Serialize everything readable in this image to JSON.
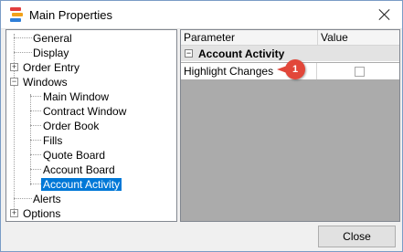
{
  "window": {
    "title": "Main Properties"
  },
  "tree": {
    "items": [
      {
        "label": "General"
      },
      {
        "label": "Display"
      },
      {
        "label": "Order Entry",
        "expander": "+"
      },
      {
        "label": "Windows",
        "expander": "−"
      },
      {
        "label": "Main Window"
      },
      {
        "label": "Contract Window"
      },
      {
        "label": "Order Book"
      },
      {
        "label": "Fills"
      },
      {
        "label": "Quote Board"
      },
      {
        "label": "Account Board"
      },
      {
        "label": "Account Activity",
        "selected": true
      },
      {
        "label": "Alerts"
      },
      {
        "label": "Options",
        "expander": "+"
      }
    ]
  },
  "grid": {
    "headers": {
      "parameter": "Parameter",
      "value": "Value"
    },
    "category": {
      "label": "Account Activity",
      "expander": "−"
    },
    "rows": [
      {
        "name": "Highlight Changes",
        "checked": false
      }
    ],
    "callout": "1"
  },
  "buttons": {
    "close": "Close"
  },
  "colors": {
    "selection": "#0078d7",
    "callout": "#e2473a"
  }
}
